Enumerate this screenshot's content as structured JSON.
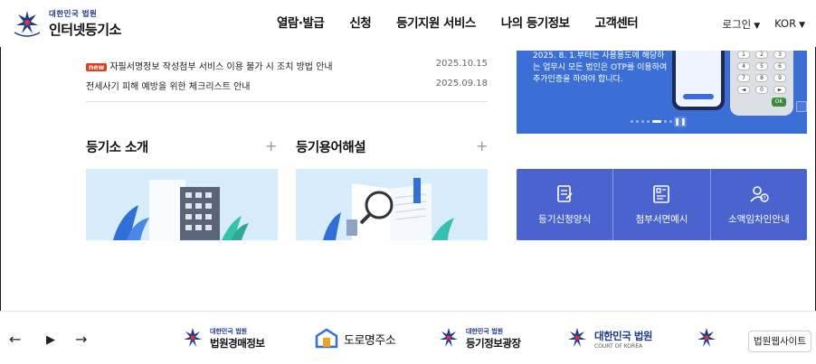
{
  "header": {
    "logo_small": "대한민국 법원",
    "logo_big": "인터넷등기소",
    "nav": [
      "열람·발급",
      "신청",
      "등기지원 서비스",
      "나의 등기정보",
      "고객센터"
    ],
    "login_label": "로그인",
    "lang_label": "KOR"
  },
  "notices": [
    {
      "badge": "new",
      "title": "자필서명정보 작성첨부 서비스 이용 불가 시 조치 방법 안내",
      "date": "2025.10.15"
    },
    {
      "badge": "",
      "title": "전세사기 피해 예방을 위한 체크리스트 안내",
      "date": "2025.09.18"
    }
  ],
  "banner": {
    "text": "2025. 8. 1.부터는 사용용도에 해당하는 업무시 모든 법인은 OTP를 이용하여 추가인증을 하여야 합니다.",
    "otp_keys": [
      "1",
      "2",
      "3",
      "4",
      "5",
      "6",
      "7",
      "8",
      "9",
      "◄",
      "0",
      "►"
    ],
    "otp_ok": "OK",
    "pause_icon": "pause-icon"
  },
  "sections": {
    "intro_title": "등기소 소개",
    "glossary_title": "등기용어해설",
    "plus_glyph": "+"
  },
  "quick_links": [
    {
      "label": "등기신청양식",
      "icon": "form-icon"
    },
    {
      "label": "첨부서면예시",
      "icon": "document-example-icon"
    },
    {
      "label": "소액임차인안내",
      "icon": "tenant-info-icon"
    }
  ],
  "footer": {
    "prev_glyph": "←",
    "play_glyph": "▶",
    "next_glyph": "→",
    "sites": [
      {
        "small": "대한민국 법원",
        "big": "법원경매정보"
      },
      {
        "small": "",
        "big": "도로명주소"
      },
      {
        "small": "대한민국 법원",
        "big": "등기정보광장"
      },
      {
        "small": "",
        "big": "대한민국 법원",
        "sub": "COURT OF KOREA"
      }
    ],
    "court_site_button": "법원웹사이트"
  },
  "colors": {
    "accent_blue": "#4b63cf",
    "banner_blue": "#3b6fd6",
    "card_bg": "#d6ecfb",
    "new_badge": "#e0401f"
  }
}
